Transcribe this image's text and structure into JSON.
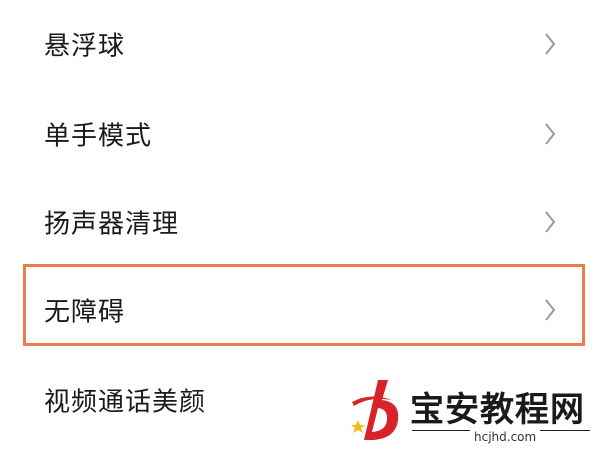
{
  "settings_list": {
    "items": [
      {
        "label": "悬浮球"
      },
      {
        "label": "单手模式"
      },
      {
        "label": "扬声器清理"
      },
      {
        "label": "无障碍"
      },
      {
        "label": "视频通话美颜"
      }
    ]
  },
  "highlight": {
    "target": "无障碍",
    "color": "#ee7a4e"
  },
  "colors": {
    "text": "#1a1a1a",
    "chevron": "#9a9a9a",
    "background": "#ffffff",
    "logo_red": "#d9232a",
    "logo_star": "#f2b90f"
  },
  "icons": {
    "row_chevron": "chevron-right-icon",
    "logo": "baoan-logo-icon"
  },
  "watermark": {
    "title": "宝安教程网",
    "url": "hcjhd.com"
  }
}
